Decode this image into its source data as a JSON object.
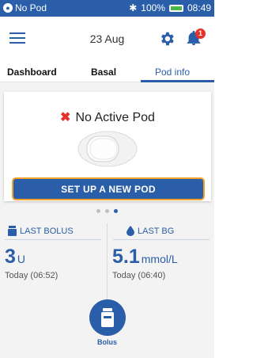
{
  "status_bar": {
    "pod_status": "No Pod",
    "battery": "100%",
    "time": "08:49"
  },
  "header": {
    "date": "23 Aug",
    "notifications_count": "1"
  },
  "tabs": [
    {
      "label": "Dashboard"
    },
    {
      "label": "Basal"
    },
    {
      "label": "Pod info"
    }
  ],
  "active_tab": "Pod info",
  "pod_card": {
    "status": "No Active Pod",
    "setup_button": "SET UP A NEW POD"
  },
  "pager": {
    "pages": 3,
    "active": 3
  },
  "last_bolus": {
    "label": "LAST BOLUS",
    "value": "3",
    "unit": "U",
    "time": "Today (06:52)"
  },
  "last_bg": {
    "label": "LAST BG",
    "value": "5.1",
    "unit": "mmol/L",
    "time": "Today (06:40)"
  },
  "bolus_button": {
    "label": "Bolus"
  },
  "colors": {
    "primary": "#2a5ea8",
    "alert": "#e5332a",
    "highlight": "#f2a12b",
    "battery": "#4cb648"
  }
}
